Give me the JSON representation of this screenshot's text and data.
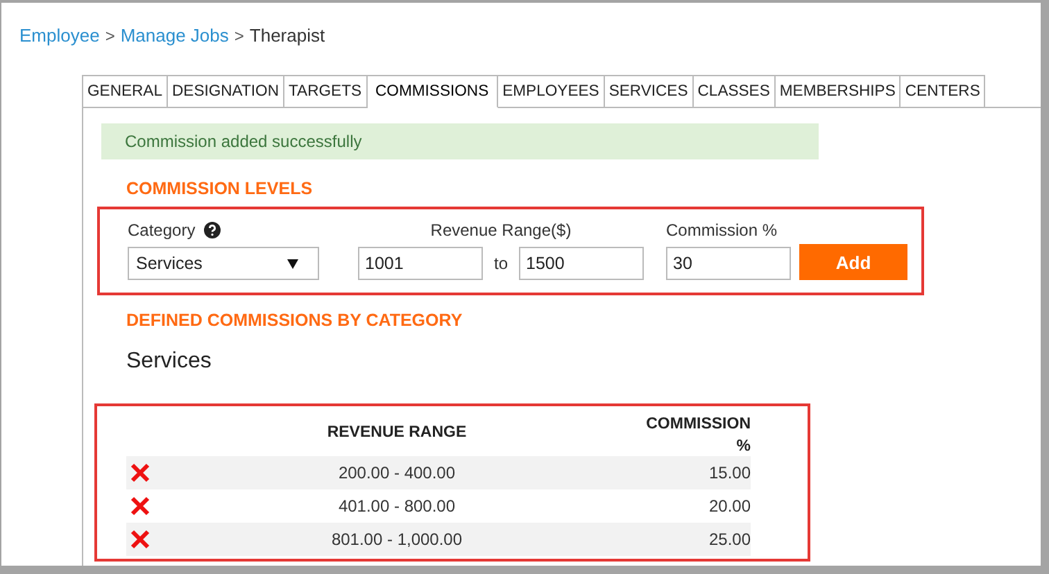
{
  "breadcrumb": [
    {
      "label": "Employee",
      "kind": "link"
    },
    {
      "label": ">",
      "kind": "separator"
    },
    {
      "label": "Manage Jobs",
      "kind": "link"
    },
    {
      "label": ">",
      "kind": "separator"
    },
    {
      "label": "Therapist",
      "kind": "current"
    }
  ],
  "tabs": [
    {
      "label": "GENERAL",
      "selected": false
    },
    {
      "label": "DESIGNATION",
      "selected": false
    },
    {
      "label": "TARGETS",
      "selected": false
    },
    {
      "label": "COMMISSIONS",
      "selected": true
    },
    {
      "label": "EMPLOYEES",
      "selected": false
    },
    {
      "label": "SERVICES",
      "selected": false
    },
    {
      "label": "CLASSES",
      "selected": false
    },
    {
      "label": "MEMBERSHIPS",
      "selected": false
    },
    {
      "label": "CENTERS",
      "selected": false
    }
  ],
  "alert": "Commission added successfully",
  "commission_levels": {
    "heading": "COMMISSION LEVELS",
    "category_label": "Category",
    "category_value": "Services",
    "range_label": "Revenue Range($)",
    "range_from": "1001",
    "range_separator": "to",
    "range_to": "1500",
    "commission_label": "Commission %",
    "commission_value": "30",
    "add_button": "Add"
  },
  "defined": {
    "heading": "DEFINED COMMISSIONS BY CATEGORY",
    "category": "Services",
    "columns": [
      "REVENUE RANGE",
      "COMMISSION %"
    ],
    "rows": [
      {
        "range": "200.00 - 400.00",
        "commission": "15.00"
      },
      {
        "range": "401.00 - 800.00",
        "commission": "20.00"
      },
      {
        "range": "801.00 - 1,000.00",
        "commission": "25.00"
      }
    ]
  }
}
